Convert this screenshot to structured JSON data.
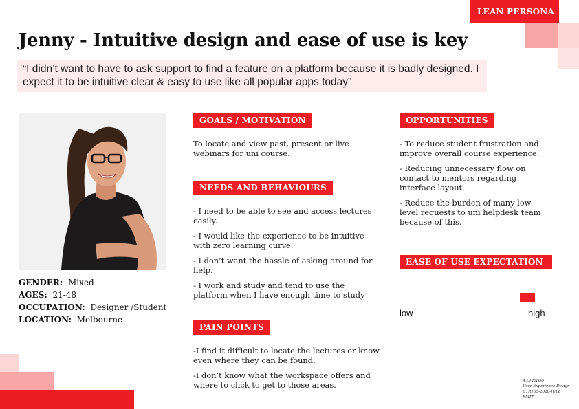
{
  "badge": "LEAN PERSONA",
  "title": "Jenny - Intuitive design and ease of use is key",
  "quote": "“I didn’t want to have to ask support to find a feature on a platform because it is badly designed. I expect it to be intuitive clear & easy to use like all popular apps today”",
  "profile": {
    "gender_label": "GENDER:",
    "gender_value": "Mixed",
    "ages_label": "AGES:",
    "ages_value": "21-48",
    "occupation_label": "OCCUPATION:",
    "occupation_value": "Designer /Student",
    "location_label": "LOCATION:",
    "location_value": "Melbourne"
  },
  "goals": {
    "heading": "GOALS / MOTIVATION",
    "items": [
      "To locate and view past, present or live webinars for uni course."
    ]
  },
  "needs": {
    "heading": "NEEDS  AND BEHAVIOURS",
    "items": [
      "- I need to be able to see and access lectures easily.",
      "- I would like the experience to be intuitive with zero learning curve.",
      "- I don’t want the hassle of asking around for help.",
      "- I work and study and tend to use the platform when I have enough time to study"
    ]
  },
  "pain": {
    "heading": "PAIN POINTS",
    "items": [
      "-I find it difficult to locate the lectures or know even where they can be found.",
      "-I don’t know what the workspace offers and where to click to get to those areas."
    ]
  },
  "opportunities": {
    "heading": "OPPORTUNITIES",
    "items": [
      "- To reduce student frustration and improve overall course experience.",
      "- Reducing unnecessary flow on contact to mentors regarding interface layout.",
      "- Reduce the burden of many low level requests to uni helpdesk team because of this."
    ]
  },
  "ease": {
    "heading": "EASE OF USE EXPECTATION",
    "low_label": "low",
    "high_label": "high",
    "level": 0.84
  },
  "credit": {
    "line1": "A.Di Russo",
    "line2": "User Experience Design",
    "line3": "DTR105-2020-JUL8",
    "line4": "RMIT"
  },
  "colors": {
    "accent": "#ee1c24",
    "accent_light": "#f9a6a6",
    "accent_pale": "#fcd5d5",
    "quote_bg": "#fdeceb"
  }
}
